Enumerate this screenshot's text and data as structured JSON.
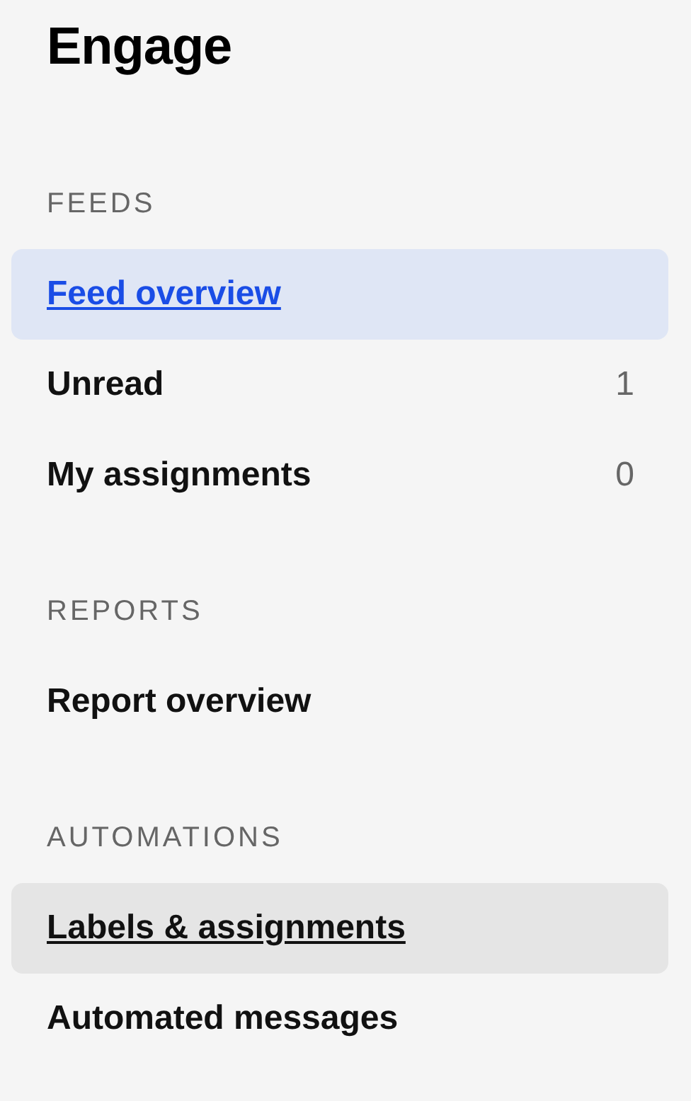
{
  "title": "Engage",
  "sections": [
    {
      "heading": "FEEDS",
      "items": [
        {
          "label": "Feed overview",
          "selected": true,
          "hovered": false
        },
        {
          "label": "Unread",
          "count": "1",
          "selected": false,
          "hovered": false
        },
        {
          "label": "My assignments",
          "count": "0",
          "selected": false,
          "hovered": false
        }
      ]
    },
    {
      "heading": "REPORTS",
      "items": [
        {
          "label": "Report overview",
          "selected": false,
          "hovered": false
        }
      ]
    },
    {
      "heading": "AUTOMATIONS",
      "items": [
        {
          "label": "Labels & assignments",
          "selected": false,
          "hovered": true
        },
        {
          "label": "Automated messages",
          "selected": false,
          "hovered": false
        }
      ]
    }
  ]
}
